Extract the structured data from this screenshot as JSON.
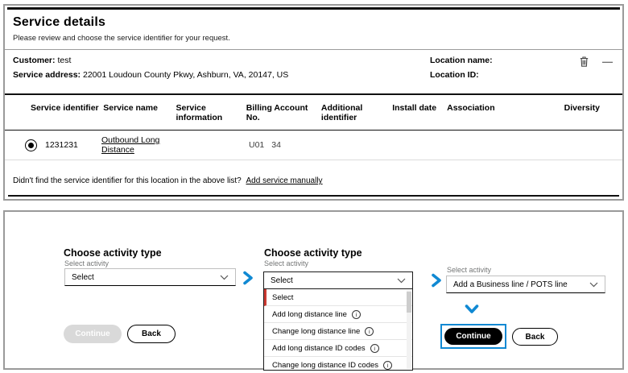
{
  "colors": {
    "accent_blue": "#1089d3",
    "accent_red": "#cb3a32"
  },
  "icons": {
    "collapse_glyph": "—",
    "info_glyph": "i"
  },
  "service_details": {
    "title": "Service details",
    "subtitle": "Please review and choose the service identifier for your request.",
    "customer": {
      "label": "Customer:",
      "value": "test"
    },
    "service_address": {
      "label": "Service address:",
      "value": "22001 Loudoun County Pkwy, Ashburn, VA, 20147, US"
    },
    "location_name_label": "Location name:",
    "location_id_label": "Location ID:",
    "table": {
      "headers": [
        "Service identifier",
        "Service name",
        "Service information",
        "Billing Account No.",
        "Additional identifier",
        "Install date",
        "Association",
        "Diversity"
      ],
      "row": {
        "service_identifier": "1231231",
        "service_name": "Outbound Long Distance",
        "billing_prefix": "U01",
        "billing_suffix": "34"
      }
    },
    "footer": {
      "text": "Didn't find the service identifier for this location in the above list?",
      "link": "Add service manually"
    }
  },
  "activity": {
    "step1": {
      "heading": "Choose activity type",
      "select_label": "Select activity",
      "select_value": "Select",
      "continue_label": "Continue",
      "back_label": "Back"
    },
    "step2": {
      "heading": "Choose activity type",
      "select_label": "Select activity",
      "select_value": "Select",
      "options": [
        "Select",
        "Add long distance line",
        "Change long distance line",
        "Add long distance ID codes",
        "Change long distance ID codes"
      ]
    },
    "step3": {
      "select_label": "Select activity",
      "select_value": "Add a Business line / POTS line",
      "continue_label": "Continue",
      "back_label": "Back"
    }
  }
}
